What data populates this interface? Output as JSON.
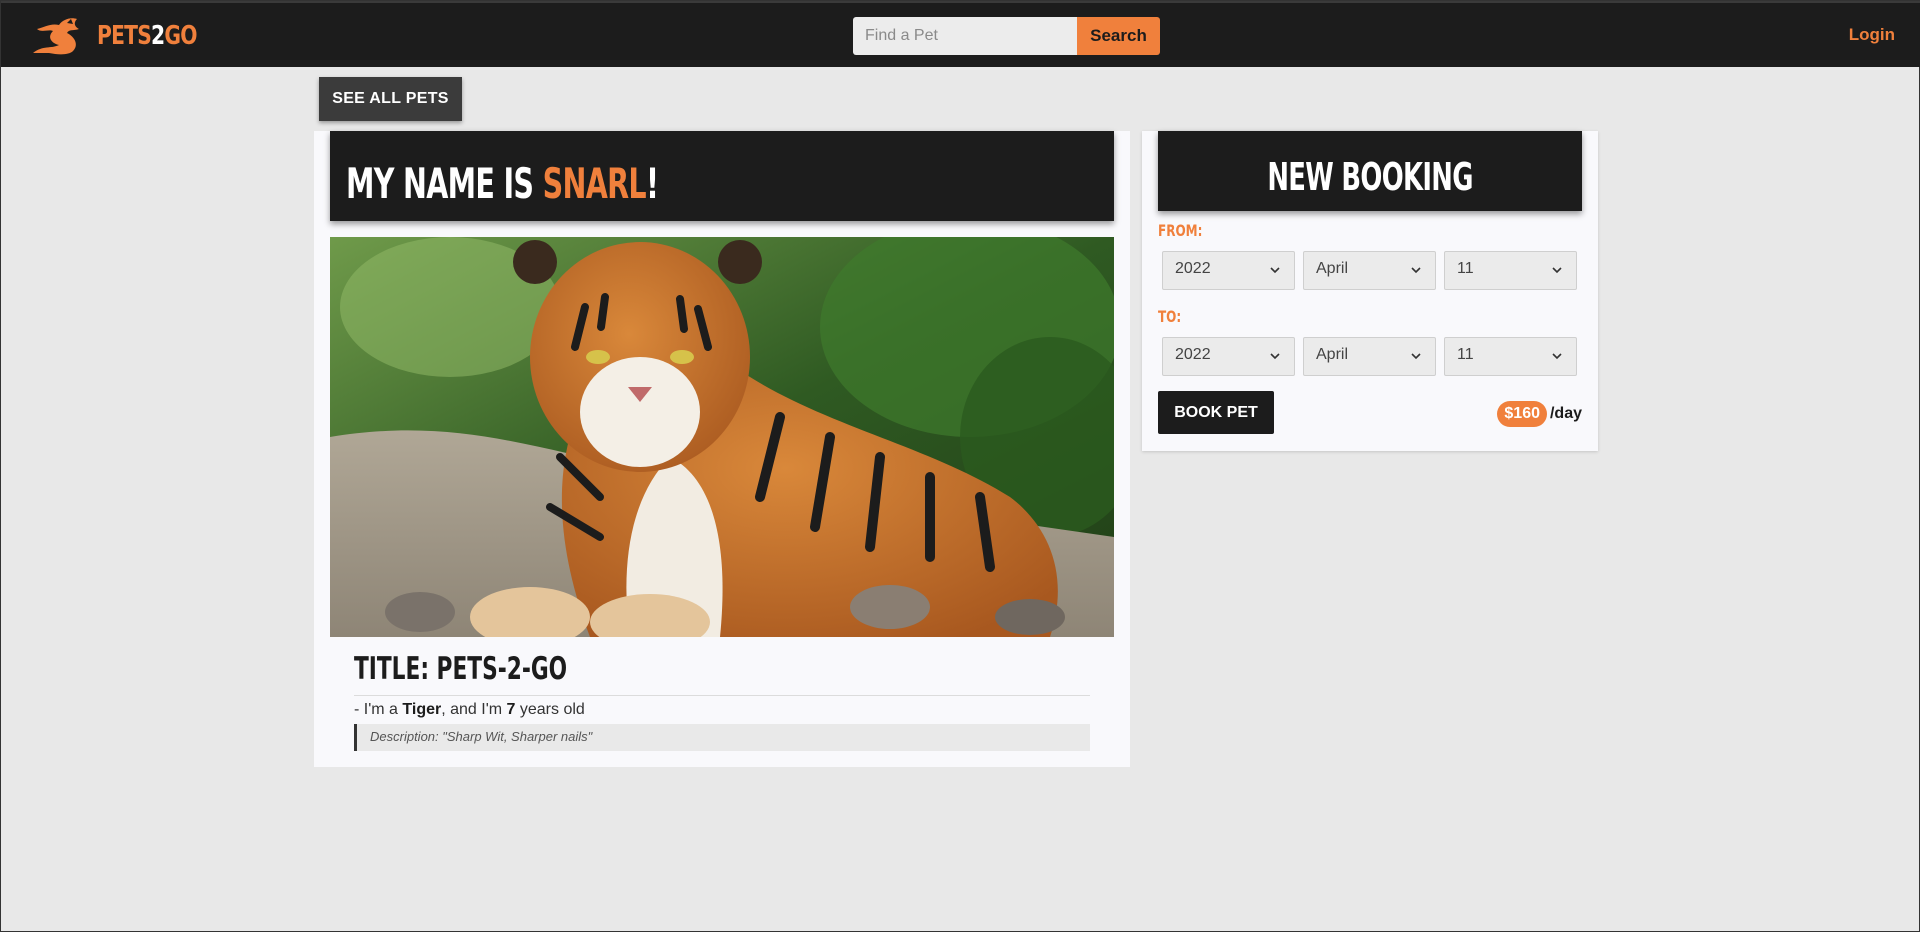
{
  "header": {
    "brand_part1": "PETS",
    "brand_part2": "2",
    "brand_part3": "GO",
    "logo_icon": "dragon-logo-icon",
    "search_placeholder": "Find a Pet",
    "search_value": "",
    "search_button": "Search",
    "login_label": "Login"
  },
  "nav": {
    "see_all_label": "SEE ALL PETS"
  },
  "pet": {
    "name_prefix": "MY NAME IS ",
    "name": "SNARL",
    "name_suffix": "!",
    "photo_icon": "tiger-photo",
    "title": "TITLE: PETS-2-GO",
    "facts_prefix": "- I'm a ",
    "species": "Tiger",
    "facts_middle": ", and I'm ",
    "age": "7",
    "facts_suffix": " years old",
    "description": "Description: \"Sharp Wit, Sharper nails\""
  },
  "booking": {
    "title": "NEW BOOKING",
    "from_label": "FROM:",
    "to_label": "TO:",
    "from": {
      "year": "2022",
      "month": "April",
      "day": "11"
    },
    "to": {
      "year": "2022",
      "month": "April",
      "day": "11"
    },
    "book_button": "BOOK PET",
    "price": "$160",
    "price_unit": "/day"
  },
  "colors": {
    "accent": "#f0803c",
    "dark": "#1c1c1c",
    "background": "#e8e8e8"
  }
}
